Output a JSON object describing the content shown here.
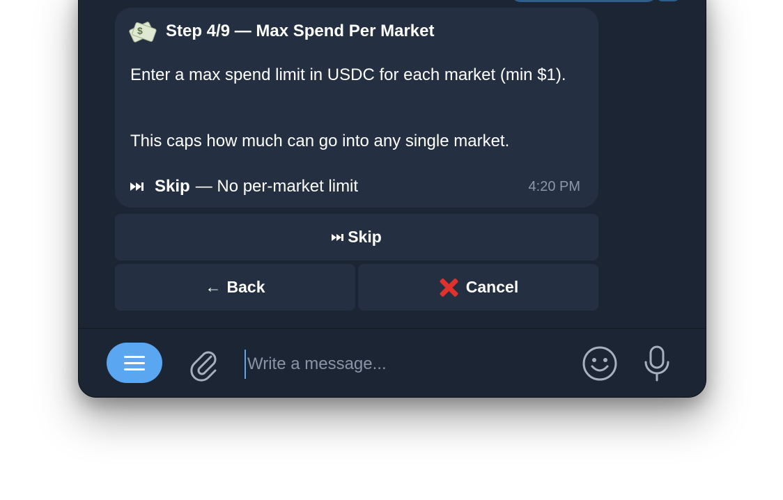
{
  "message": {
    "title": "Step 4/9 — Max Spend Per Market",
    "icon": "money-with-wings-icon",
    "text1": "Enter a max spend limit in USDC for each market (min $1).",
    "text2": "This caps how much can go into any single market.",
    "skip_label": "Skip",
    "skip_desc": "— No per-market limit",
    "time": "4:20 PM"
  },
  "keyboard": {
    "skip_label": "Skip",
    "back_label": "Back",
    "cancel_label": "Cancel"
  },
  "composer": {
    "placeholder": "Write a message..."
  },
  "colors": {
    "window_bg": "#1c2533",
    "bubble_bg": "#243041",
    "accent": "#5aa6f0",
    "cancel_red": "#e0312c"
  }
}
